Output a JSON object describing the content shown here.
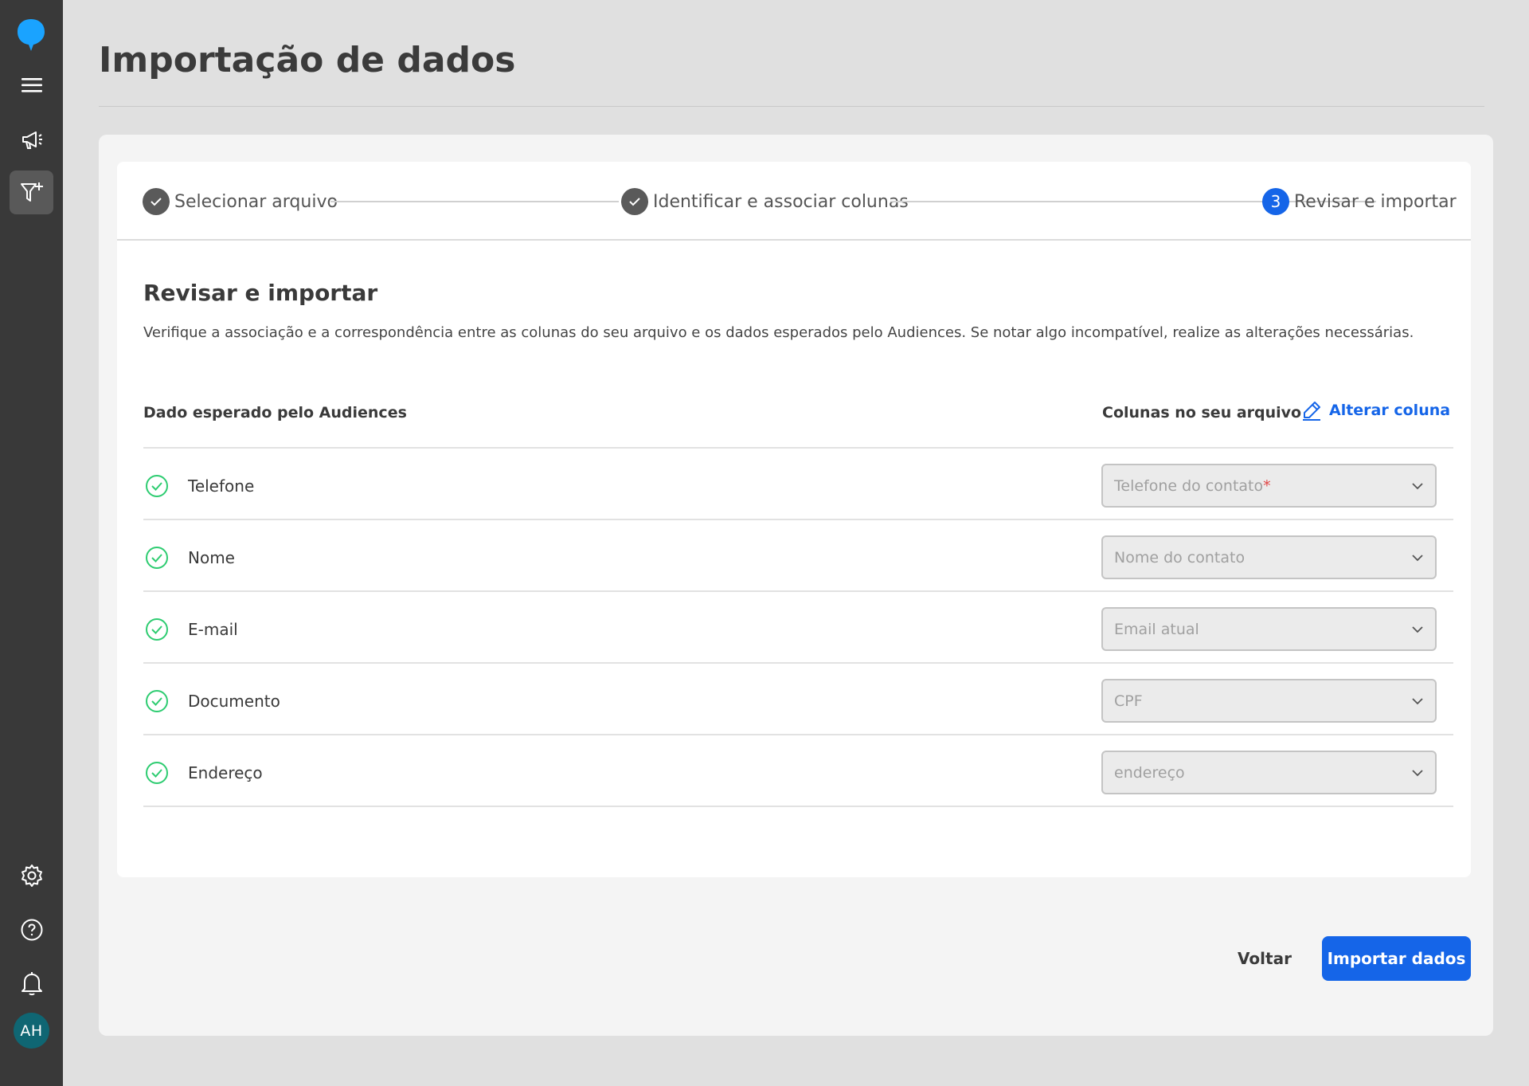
{
  "sidebar": {
    "avatar_initials": "AH",
    "icons": [
      "logo-icon",
      "menu-icon",
      "megaphone-icon",
      "filter-add-icon",
      "gear-icon",
      "help-icon",
      "bell-icon"
    ]
  },
  "page": {
    "title": "Importação de dados"
  },
  "stepper": {
    "steps": [
      {
        "label": "Selecionar arquivo",
        "status": "done"
      },
      {
        "label": "Identificar e associar colunas",
        "status": "done"
      },
      {
        "label": "Revisar e importar",
        "status": "current",
        "number": "3"
      }
    ]
  },
  "review": {
    "title": "Revisar e importar",
    "description": "Verifique a associação e a correspondência entre as colunas do seu arquivo e os dados esperados pelo Audiences. Se notar algo incompatível, realize as alterações necessárias.",
    "col_expected": "Dado esperado pelo Audiences",
    "col_file": "Colunas no seu arquivo",
    "change_column": "Alterar coluna",
    "rows": [
      {
        "label": "Telefone",
        "selected": "Telefone do contato",
        "required": "*"
      },
      {
        "label": "Nome",
        "selected": "Nome do contato"
      },
      {
        "label": "E-mail",
        "selected": "Email atual"
      },
      {
        "label": "Documento",
        "selected": "CPF"
      },
      {
        "label": "Endereço",
        "selected": "endereço"
      }
    ]
  },
  "actions": {
    "back": "Voltar",
    "import": "Importar dados"
  },
  "colors": {
    "accent": "#1565e8",
    "success": "#2ecc71",
    "sidebar": "#393939"
  }
}
